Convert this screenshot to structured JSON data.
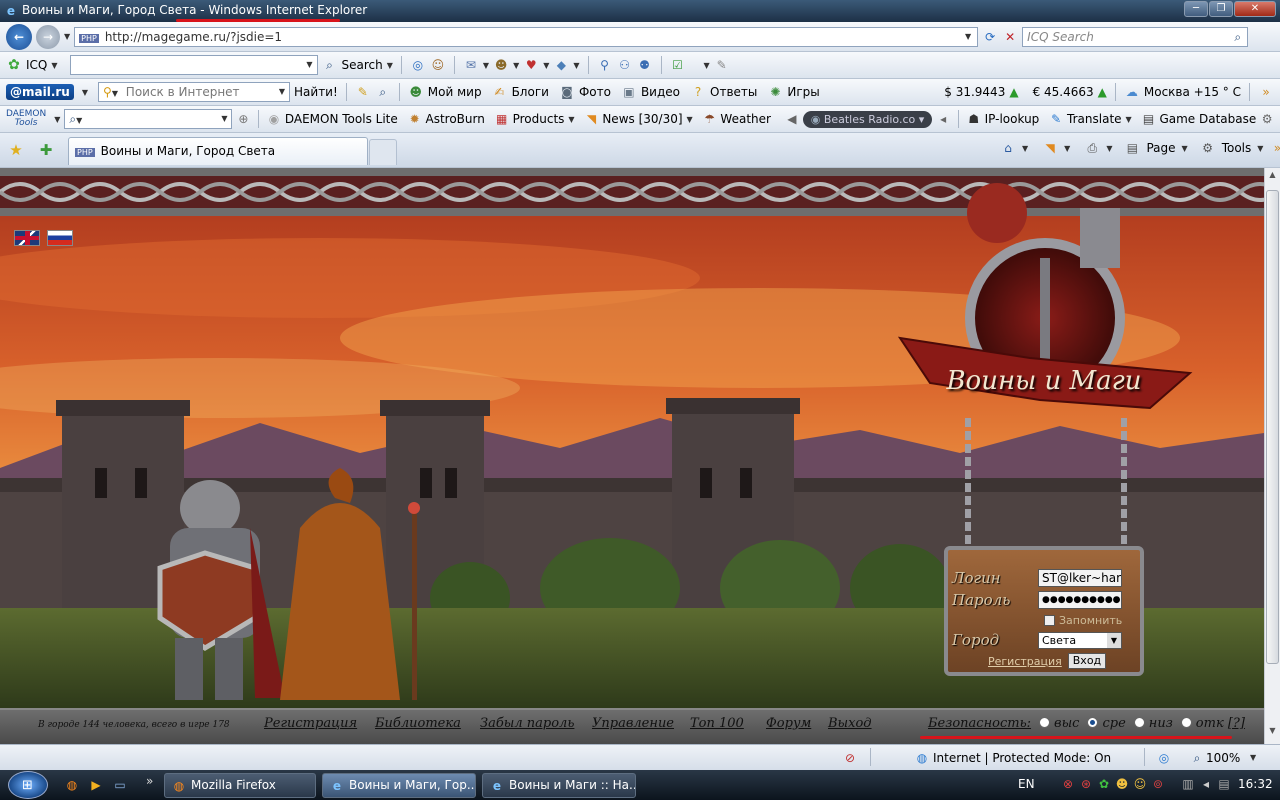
{
  "window": {
    "title_prefix": "Воины и Маги, Город Света - ",
    "title_app": "Windows Internet Explorer"
  },
  "address": {
    "url": "http://magegame.ru/?jsdie=1",
    "search_placeholder": "ICQ Search"
  },
  "icq_bar": {
    "label": "ICQ",
    "search_label": "Search"
  },
  "mail_bar": {
    "logo": "@mail.ru",
    "search_placeholder": "Поиск в Интернет",
    "find_button": "Найти!",
    "links": [
      "Мой мир",
      "Блоги",
      "Фото",
      "Видео",
      "Ответы",
      "Игры"
    ],
    "usd": "$ 31.9443",
    "eur": "€ 45.4663",
    "weather": "Москва +15 ° C"
  },
  "daemon_bar": {
    "logo_line1": "DAEMON",
    "logo_line2": "Tools",
    "items": [
      "DAEMON Tools Lite",
      "AstroBurn",
      "Products",
      "News [30/30]",
      "Weather"
    ],
    "radio": "Beatles Radio.co",
    "ip": "IP-lookup",
    "translate": "Translate",
    "gamedb": "Game Database"
  },
  "tabs": {
    "active": "Воины и Маги, Город Света",
    "home": "",
    "page": "Page",
    "tools": "Tools"
  },
  "game": {
    "logo": "Воины и Маги",
    "login_label": "Логин",
    "login_value": "ST@lker~har",
    "password_label": "Пароль",
    "password_value": "●●●●●●●●●●",
    "remember": "Запомнить",
    "city_label": "Город",
    "city_value": "Света",
    "register": "Регистрация",
    "enter": "Вход",
    "online": "В городе 144 человека, всего в игре 178",
    "links": [
      "Регистрация",
      "Библиотека",
      "Забыл пароль",
      "Управление",
      "Топ 100",
      "Форум",
      "Выход"
    ],
    "security_label": "Безопасность:",
    "security_options": [
      "выс",
      "сре",
      "низ",
      "отк"
    ],
    "security_help": "[?]",
    "security_selected": "сре"
  },
  "status": {
    "zone": "Internet | Protected Mode: On",
    "zoom": "100%"
  },
  "taskbar": {
    "items": [
      "Mozilla Firefox",
      "Воины и Маги, Гор...",
      "Воины и Маги :: На..."
    ],
    "lang": "EN",
    "time": "16:32"
  },
  "colors": {
    "accent_red": "#d8141b",
    "sky_top": "#c3441f",
    "sky_mid": "#e98433",
    "wall": "#4e4342"
  }
}
